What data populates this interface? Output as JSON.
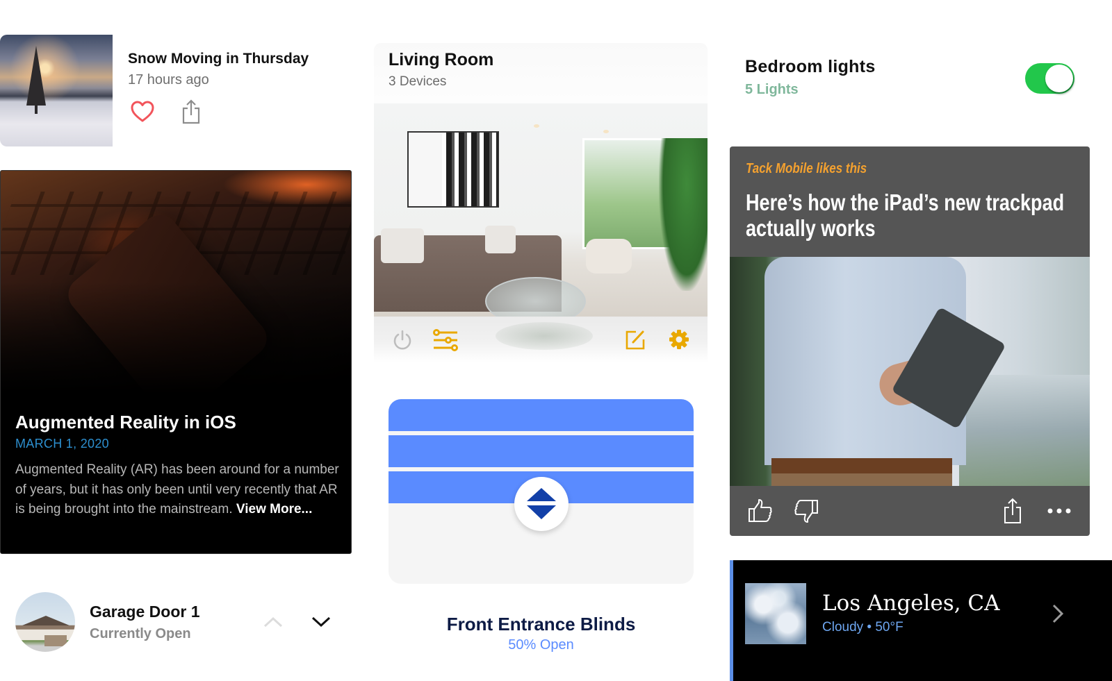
{
  "snow_card": {
    "title": "Snow Moving in Thursday",
    "time": "17 hours ago",
    "icons": {
      "like": "heart-icon",
      "share": "share-icon"
    },
    "like_color": "#f2545b"
  },
  "ar_card": {
    "title": "Augmented Reality in iOS",
    "date": "MARCH 1, 2020",
    "body": "Augmented Reality (AR) has been around for a number of years, but it has only been until very recently that AR is being brought into the mainstream.",
    "link": "View More...",
    "date_color": "#2d8fcf"
  },
  "garage": {
    "title": "Garage Door 1",
    "status": "Currently Open",
    "icons": {
      "up": "chevron-up-icon",
      "down": "chevron-down-icon"
    }
  },
  "living_room": {
    "title": "Living Room",
    "devices": "3 Devices",
    "toolbar": {
      "power": "power-icon",
      "settings_sliders": "sliders-icon",
      "edit": "edit-icon",
      "gear": "gear-icon"
    },
    "accent": "#e9a800"
  },
  "blinds": {
    "title": "Front Entrance Blinds",
    "status": "50% Open",
    "open_percent": 50,
    "slat_color": "#5a8bff",
    "handle_arrow_color": "#1240a8"
  },
  "bedroom": {
    "title": "Bedroom lights",
    "count": "5 Lights",
    "toggle_on": true,
    "toggle_color": "#22c74b"
  },
  "news": {
    "liker": "Tack Mobile likes this",
    "title": "Here’s how the iPad’s new trackpad actually works",
    "actions": [
      "thumbs-up-icon",
      "thumbs-down-icon",
      "share-icon",
      "more-icon"
    ],
    "liker_color": "#f4a12f"
  },
  "weather": {
    "city": "Los Angeles, CA",
    "condition": "Cloudy • 50°F",
    "accent": "#5b8ee6"
  }
}
